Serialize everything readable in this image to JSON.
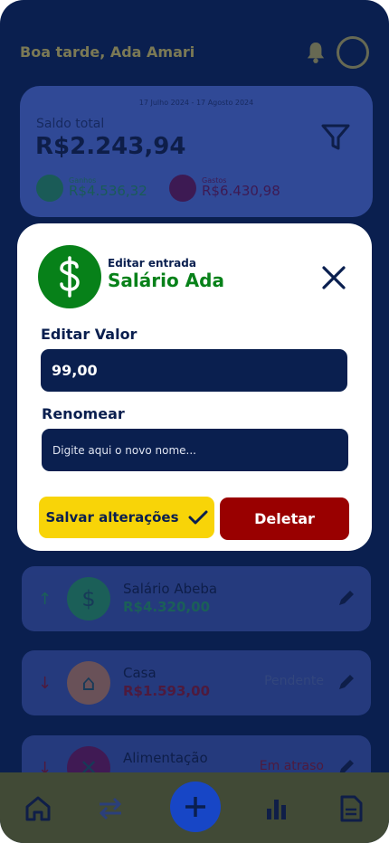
{
  "header": {
    "greeting": "Boa tarde, Ada Amari"
  },
  "summary": {
    "date_range": "17 Julho 2024 - 17 Agosto 2024",
    "label": "Saldo total",
    "total": "R$2.243,94",
    "income": {
      "caption": "Ganhos",
      "value": "R$4.536,32"
    },
    "expense": {
      "caption": "Gastos",
      "value": "R$6.430,98"
    }
  },
  "transactions": [
    {
      "name": "Salário Abeba",
      "amount": "R$4.320,00",
      "status": "",
      "direction": "up",
      "icon": "dollar-icon"
    },
    {
      "name": "Casa",
      "amount": "R$1.593,00",
      "status": "Pendente",
      "direction": "down",
      "icon": "house-icon"
    },
    {
      "name": "Alimentação",
      "amount": "",
      "status": "Em atraso",
      "direction": "down",
      "icon": "food-icon"
    }
  ],
  "modal": {
    "subtitle": "Editar entrada",
    "title": "Salário Ada",
    "value_label": "Editar Valor",
    "value": "99,00",
    "rename_label": "Renomear",
    "rename_placeholder": "Digite aqui o novo nome...",
    "save_label": "Salvar alterações",
    "delete_label": "Deletar"
  },
  "nav": [
    "home-icon",
    "transfer-icon",
    "add-icon",
    "chart-icon",
    "report-icon"
  ],
  "colors": {
    "navy": "#0a1f4f",
    "green": "#078119",
    "yellow": "#f8d408",
    "red": "#990000",
    "overlay_blue": "#0a1f4f"
  }
}
